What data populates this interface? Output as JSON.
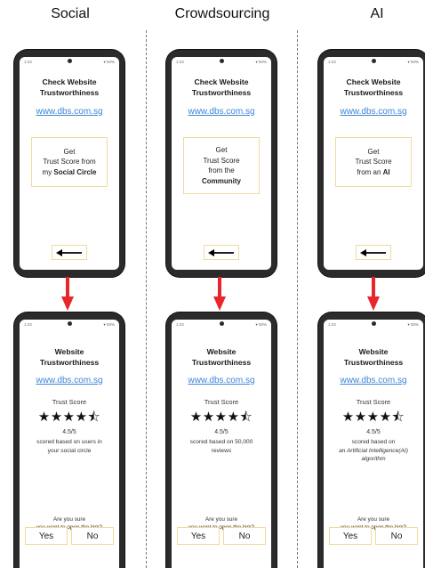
{
  "columns": [
    {
      "heading": "Social",
      "top_screen": {
        "status_time": "1:23",
        "status_right": "▾ 94%",
        "title_line1": "Check Website",
        "title_line2": "Trustworthiness",
        "link": "www.dbs.com.sg",
        "box_line1": "Get",
        "box_line2": "Trust Score from",
        "box_line3_pre": "my ",
        "box_line3_bold": "Social Circle"
      },
      "bottom_screen": {
        "status_time": "1:23",
        "status_right": "▾ 93%",
        "title_line1": "Website",
        "title_line2": "Trustworthiness",
        "link": "www.dbs.com.sg",
        "trust_label": "Trust Score",
        "stars": "★★★★⯪",
        "rating": "4.5/5",
        "scored_line1": "scored based on users in",
        "scored_line2": "your social circle",
        "confirm_line1": "Are you sure",
        "confirm_line2": "you want to open the link?",
        "yes": "Yes",
        "no": "No"
      }
    },
    {
      "heading": "Crowdsourcing",
      "top_screen": {
        "status_time": "1:23",
        "status_right": "▾ 94%",
        "title_line1": "Check Website",
        "title_line2": "Trustworthiness",
        "link": "www.dbs.com.sg",
        "box_line1": "Get",
        "box_line2": "Trust Score",
        "box_line3_pre": "from the",
        "box_line3_bold": "Community"
      },
      "bottom_screen": {
        "status_time": "1:23",
        "status_right": "▾ 93%",
        "title_line1": "Website",
        "title_line2": "Trustworthiness",
        "link": "www.dbs.com.sg",
        "trust_label": "Trust Score",
        "stars": "★★★★⯪",
        "rating": "4.5/5",
        "scored_line1": "scored based on 50,000",
        "scored_line2": "reviews",
        "confirm_line1": "Are you sure",
        "confirm_line2": "you want to open the link?",
        "yes": "Yes",
        "no": "No"
      }
    },
    {
      "heading": "AI",
      "top_screen": {
        "status_time": "1:23",
        "status_right": "▾ 94%",
        "title_line1": "Check Website",
        "title_line2": "Trustworthiness",
        "link": "www.dbs.com.sg",
        "box_line1": "Get",
        "box_line2": "Trust Score",
        "box_line3_pre": "from an ",
        "box_line3_bold": "AI"
      },
      "bottom_screen": {
        "status_time": "1:23",
        "status_right": "▾ 93%",
        "title_line1": "Website",
        "title_line2": "Trustworthiness",
        "link": "www.dbs.com.sg",
        "trust_label": "Trust Score",
        "stars": "★★★★⯪",
        "rating": "4.5/5",
        "scored_line1": "scored based on",
        "scored_line2": "an Artificial Intelligence(AI)",
        "scored_line3": "algorithm",
        "confirm_line1": "Are you sure",
        "confirm_line2": "you want to open the link?",
        "yes": "Yes",
        "no": "No"
      }
    }
  ],
  "colors": {
    "link": "#3d84d8",
    "arrow": "#e8262b",
    "button_border": "#f2d9a0",
    "phone_frame": "#2b2b2b"
  }
}
